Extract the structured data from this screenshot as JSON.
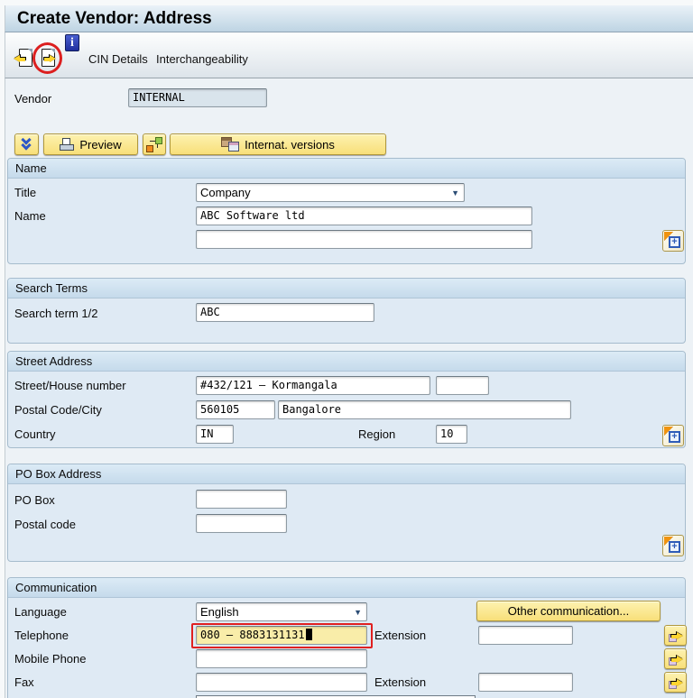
{
  "window": {
    "title": "Create Vendor: Address"
  },
  "toolbar": {
    "cin_details": "CIN Details",
    "interchangeability": "Interchangeability"
  },
  "header_fields": {
    "vendor_label": "Vendor",
    "vendor_value": "INTERNAL"
  },
  "action_bar": {
    "preview": "Preview",
    "internat_versions": "Internat. versions"
  },
  "name_section": {
    "header": "Name",
    "title_label": "Title",
    "title_value": "Company",
    "name_label": "Name",
    "name_value": "ABC Software ltd",
    "name_line2_value": ""
  },
  "search_section": {
    "header": "Search Terms",
    "term_label": "Search term 1/2",
    "term_value": "ABC"
  },
  "street_section": {
    "header": "Street Address",
    "street_label": "Street/House number",
    "street_value": "#432/121 – Kormangala",
    "street_supplement_value": "",
    "postal_city_label": "Postal Code/City",
    "postal_value": "560105",
    "city_value": "Bangalore",
    "country_label": "Country",
    "country_value": "IN",
    "region_label": "Region",
    "region_value": "10"
  },
  "pobox_section": {
    "header": "PO Box Address",
    "pobox_label": "PO Box",
    "pobox_value": "",
    "postal_label": "Postal code",
    "postal_value": ""
  },
  "comm_section": {
    "header": "Communication",
    "language_label": "Language",
    "language_value": "English",
    "other_button": "Other communication...",
    "telephone_label": "Telephone",
    "telephone_value": "080 – 8883131131",
    "extension_label": "Extension",
    "telephone_extension_value": "",
    "mobile_label": "Mobile Phone",
    "mobile_value": "",
    "fax_label": "Fax",
    "fax_value": "",
    "fax_extension_value": ""
  },
  "icons": {
    "dropdown_arrow": "▼",
    "info_glyph": "i",
    "plus_glyph": "+"
  },
  "colors": {
    "button_yellow": "#f8df79",
    "focused_field_bg": "#f9eda9",
    "annotation_red": "#e02020",
    "group_bg": "#dfeaf4",
    "group_header_bg": "#cfe1f0",
    "titlebar_bg": "#c9dcea"
  }
}
